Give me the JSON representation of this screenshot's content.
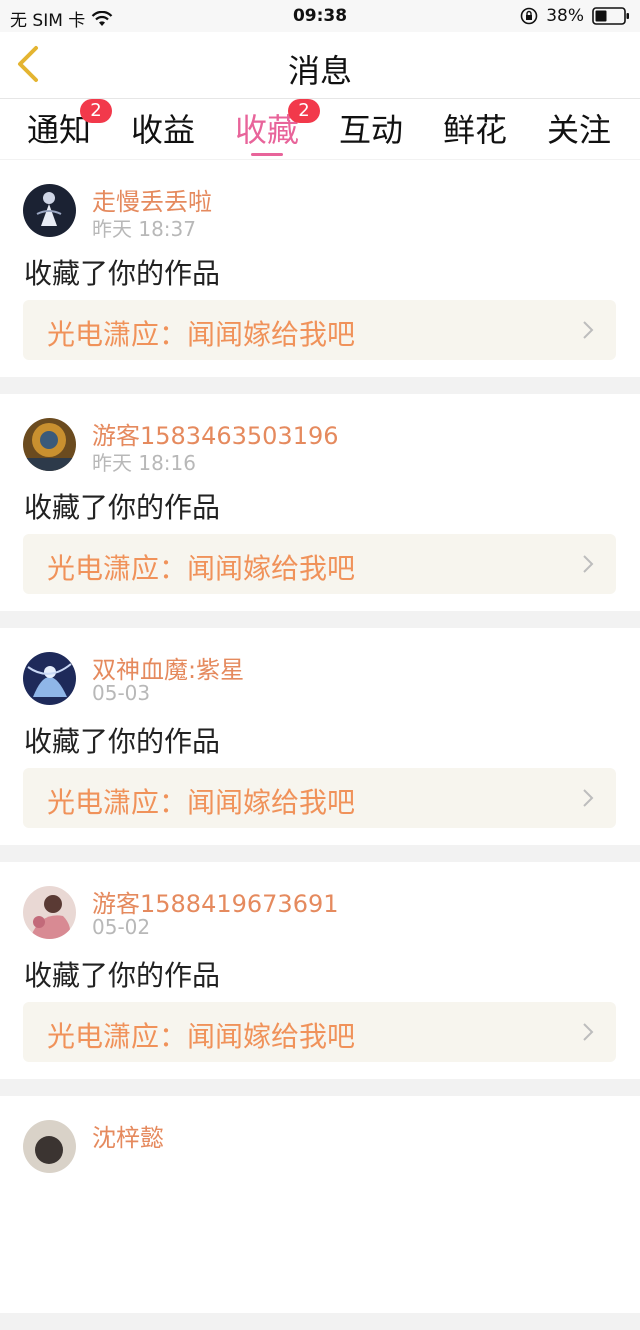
{
  "status_bar": {
    "carrier": "无 SIM 卡",
    "time": "09:38",
    "battery": "38%"
  },
  "header": {
    "title": "消息"
  },
  "tabs": [
    {
      "label": "通知",
      "badge": "2",
      "active": false
    },
    {
      "label": "收益",
      "badge": "",
      "active": false
    },
    {
      "label": "收藏",
      "badge": "2",
      "active": true
    },
    {
      "label": "互动",
      "badge": "",
      "active": false
    },
    {
      "label": "鲜花",
      "badge": "",
      "active": false
    },
    {
      "label": "关注",
      "badge": "",
      "active": false
    }
  ],
  "feed": [
    {
      "username": "走慢丢丢啦",
      "time": "昨天 18:37",
      "action": "收藏了你的作品",
      "work": "光电潇应：闻闻嫁给我吧"
    },
    {
      "username": "游客1583463503196",
      "time": "昨天 18:16",
      "action": "收藏了你的作品",
      "work": "光电潇应：闻闻嫁给我吧"
    },
    {
      "username": "双神血魔:紫星",
      "time": "05-03",
      "action": "收藏了你的作品",
      "work": "光电潇应：闻闻嫁给我吧"
    },
    {
      "username": "游客1588419673691",
      "time": "05-02",
      "action": "收藏了你的作品",
      "work": "光电潇应：闻闻嫁给我吧"
    },
    {
      "username": "沈梓懿",
      "time": "",
      "action": "",
      "work": ""
    }
  ],
  "colors": {
    "accent": "#e8649a",
    "badge": "#f2394b",
    "username": "#e58a5e",
    "work_title": "#f0925a",
    "back_arrow": "#e4b431"
  }
}
